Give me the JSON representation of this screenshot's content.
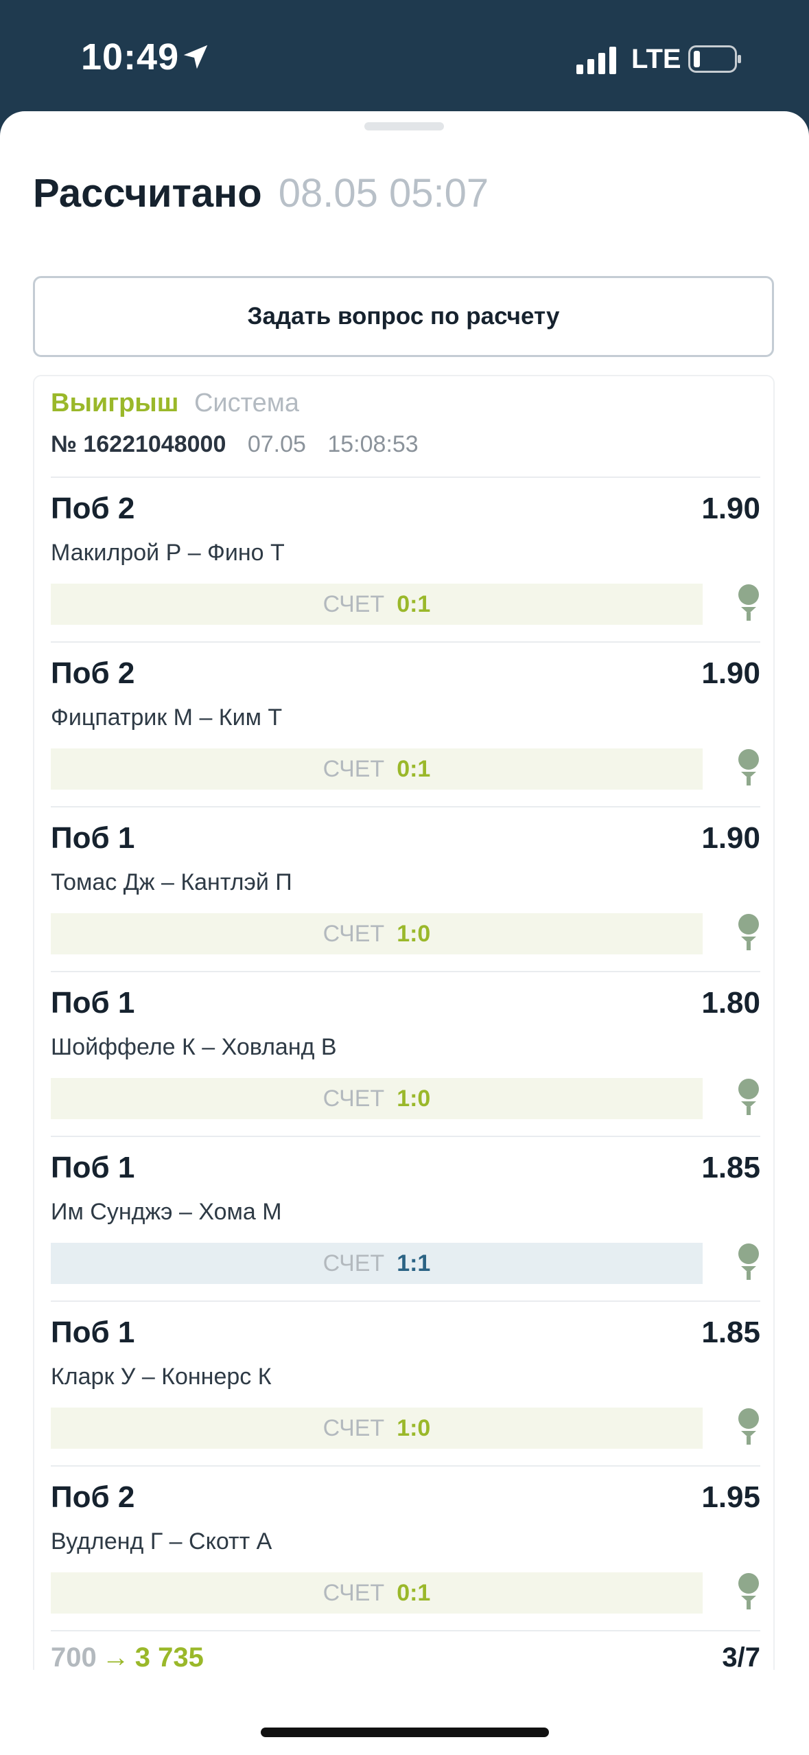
{
  "status_bar": {
    "time": "10:49",
    "network": "LTE",
    "icons": [
      "location-arrow-icon",
      "signal-icon",
      "battery-icon"
    ]
  },
  "header": {
    "title": "Рассчитано",
    "date": "08.05 05:07"
  },
  "ask_button": {
    "label": "Задать вопрос по расчету"
  },
  "bet_slip": {
    "status": "Выигрыш",
    "type": "Система",
    "number": "№ 16221048000",
    "date": "07.05",
    "time": "15:08:53",
    "selections": [
      {
        "market": "Поб 2",
        "odds": "1.90",
        "event": "Макилрой Р – Фино Т",
        "score_label": "СЧЕТ",
        "score": "0:1",
        "result": "win"
      },
      {
        "market": "Поб 2",
        "odds": "1.90",
        "event": "Фицпатрик М – Ким Т",
        "score_label": "СЧЕТ",
        "score": "0:1",
        "result": "win"
      },
      {
        "market": "Поб 1",
        "odds": "1.90",
        "event": "Томас Дж – Кантлэй П",
        "score_label": "СЧЕТ",
        "score": "1:0",
        "result": "win"
      },
      {
        "market": "Поб 1",
        "odds": "1.80",
        "event": "Шойффеле К – Ховланд В",
        "score_label": "СЧЕТ",
        "score": "1:0",
        "result": "win"
      },
      {
        "market": "Поб 1",
        "odds": "1.85",
        "event": "Им Сунджэ – Хома М",
        "score_label": "СЧЕТ",
        "score": "1:1",
        "result": "draw"
      },
      {
        "market": "Поб 1",
        "odds": "1.85",
        "event": "Кларк У – Коннерс К",
        "score_label": "СЧЕТ",
        "score": "1:0",
        "result": "win"
      },
      {
        "market": "Поб 2",
        "odds": "1.95",
        "event": "Вудленд Г – Скотт А",
        "score_label": "СЧЕТ",
        "score": "0:1",
        "result": "win"
      }
    ],
    "summary": {
      "stake": "700",
      "arrow": "→",
      "payout": "3 735",
      "count": "3/7"
    }
  },
  "colors": {
    "header_bg": "#1f3a4f",
    "accent_green": "#9ab82a",
    "draw_blue": "#2b6384",
    "golf_icon": "#8fa88c"
  }
}
